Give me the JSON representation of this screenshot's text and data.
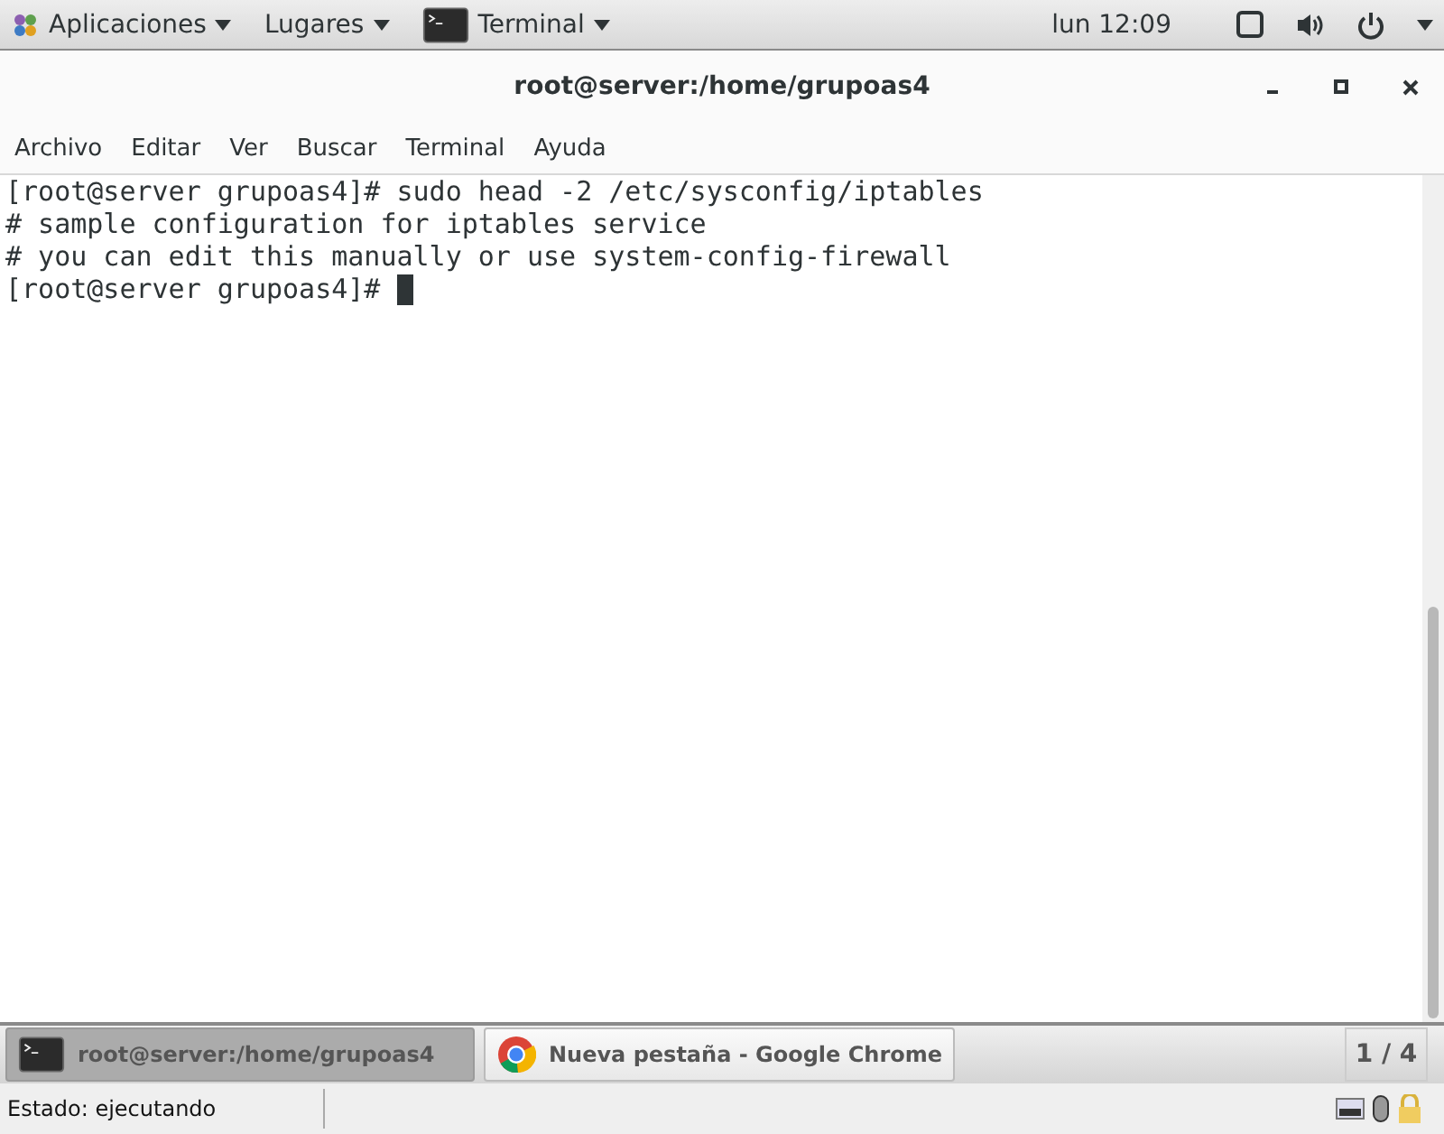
{
  "top_bar": {
    "menus": [
      {
        "label": "Aplicaciones",
        "kind": "apps"
      },
      {
        "label": "Lugares"
      },
      {
        "label": "Terminal",
        "kind": "terminal"
      }
    ],
    "clock": "lun 12:09"
  },
  "window": {
    "title": "root@server:/home/grupoas4"
  },
  "menu_bar": [
    "Archivo",
    "Editar",
    "Ver",
    "Buscar",
    "Terminal",
    "Ayuda"
  ],
  "terminal": {
    "lines": [
      "[root@server grupoas4]# sudo head -2 /etc/sysconfig/iptables",
      "# sample configuration for iptables service",
      "# you can edit this manually or use system-config-firewall",
      "[root@server grupoas4]# "
    ]
  },
  "taskbar": {
    "tasks": [
      {
        "label": "root@server:/home/grupoas4",
        "kind": "terminal",
        "selected": true
      },
      {
        "label": "Nueva pestaña - Google Chrome",
        "kind": "chrome",
        "selected": false
      }
    ],
    "workspace": "1 / 4"
  },
  "status_bar": {
    "text": "Estado: ejecutando"
  }
}
